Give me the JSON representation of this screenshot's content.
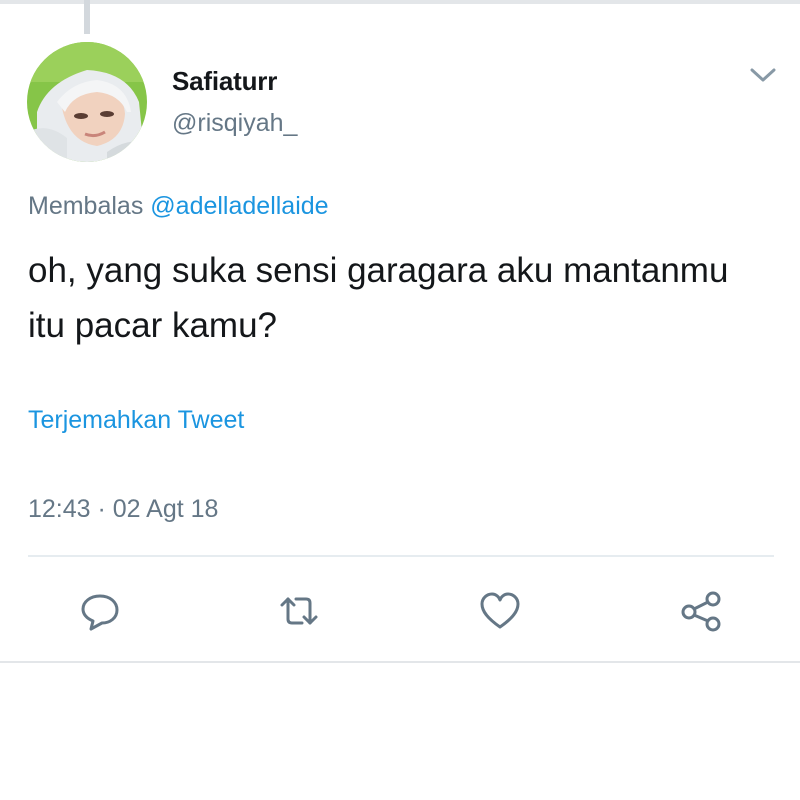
{
  "tweet": {
    "author": {
      "display_name": "Safiaturr",
      "handle": "@risqiyah_"
    },
    "reply_prefix": "Membalas",
    "reply_to": "@adelladellaide",
    "text": "oh, yang suka sensi garagara aku mantanmu itu pacar kamu?",
    "translate_label": "Terjemahkan Tweet",
    "timestamp": "12:43 · 02 Agt 18"
  },
  "icons": {
    "more": "chevron-down-icon",
    "reply": "reply-icon",
    "retweet": "retweet-icon",
    "like": "heart-icon",
    "share": "share-icon"
  },
  "colors": {
    "link": "#1b95e0",
    "secondary_text": "#657786",
    "primary_text": "#14171a",
    "icon": "#657786",
    "avatar_background": "#8cc63f"
  }
}
